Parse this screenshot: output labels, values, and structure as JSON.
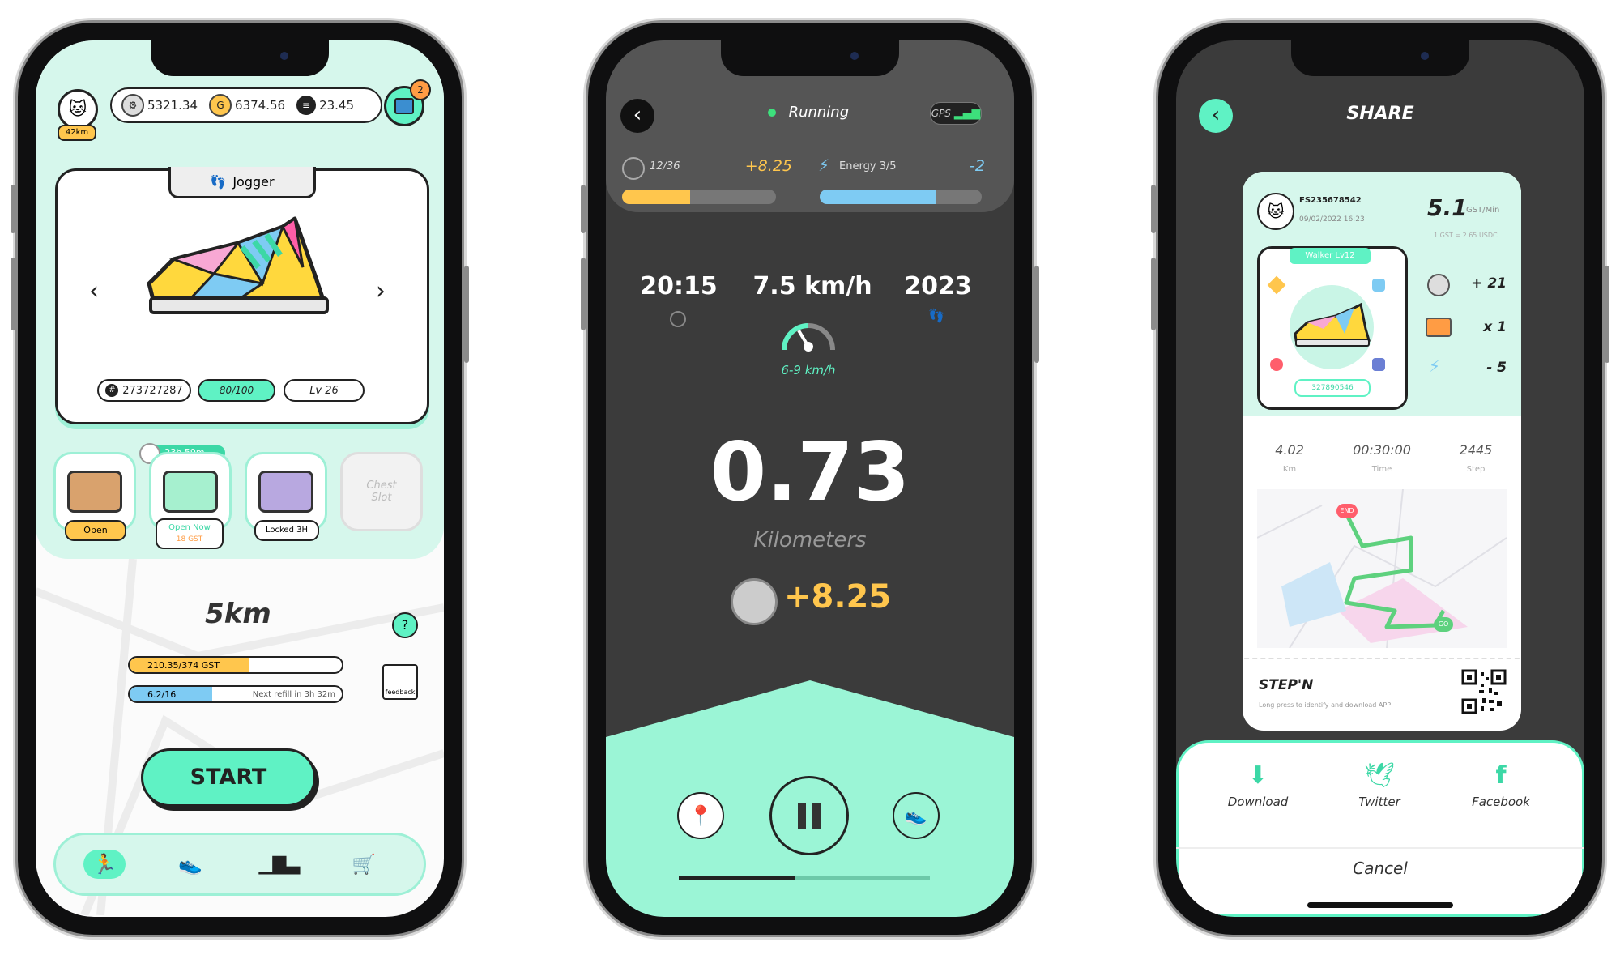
{
  "colors": {
    "mint": "#5ff2c4",
    "mint_light": "#d6f7ec",
    "orange": "#ffc64d",
    "blue": "#7ecbf3",
    "dark": "#3b3b3b"
  },
  "screen1": {
    "distance_badge": "42km",
    "balances": {
      "gst": "5321.34",
      "gmt": "6374.56",
      "sol": "23.45"
    },
    "wallet_badge": "2",
    "sneaker_type": "Jogger",
    "sneaker_id": "273727287",
    "durability": "80/100",
    "level": "Lv 26",
    "chests": [
      {
        "status": "Open"
      },
      {
        "timer": "23h 59m",
        "status": "Open Now",
        "cost": "18 GST"
      },
      {
        "status": "Locked 3H"
      },
      {
        "label": "Chest Slot"
      }
    ],
    "target": "5km",
    "gst_progress": {
      "label": "210.35/374 GST",
      "fraction": 0.56
    },
    "energy": {
      "label": "6.2/16",
      "refill": "Next refill in 3h 32m",
      "fraction": 0.39
    },
    "feedback_label": "feedback",
    "start_label": "START"
  },
  "screen2": {
    "status": "Running",
    "gps_label": "GPS",
    "gst_counter": "12/36",
    "gst_gain": "+8.25",
    "gst_fraction": 0.44,
    "energy_label": "Energy 3/5",
    "energy_change": "-2",
    "energy_fraction": 0.72,
    "time": "20:15",
    "speed": "7.5 km/h",
    "steps": "2023",
    "speed_range": "6-9 km/h",
    "distance": "0.73",
    "distance_unit": "Kilometers",
    "earned": "+8.25"
  },
  "screen3": {
    "title": "SHARE",
    "user_id": "FS235678542",
    "datetime": "09/02/2022 16:23",
    "rate": "5.1",
    "rate_unit": "GST/Min",
    "rate_conversion": "1 GST = 2.65 USDC",
    "sneaker_label": "Walker Lv12",
    "sneaker_id": "327890546",
    "rewards": [
      {
        "value": "+ 21"
      },
      {
        "value": "x 1"
      },
      {
        "value": "- 5"
      }
    ],
    "stats": [
      {
        "value": "4.02",
        "label": "Km"
      },
      {
        "value": "00:30:00",
        "label": "Time"
      },
      {
        "value": "2445",
        "label": "Step"
      }
    ],
    "map_start": "END",
    "map_end": "GO",
    "brand": "STEP'N",
    "qr_caption": "Long press to identify and download APP",
    "actions": [
      {
        "label": "Download"
      },
      {
        "label": "Twitter"
      },
      {
        "label": "Facebook"
      }
    ],
    "cancel_label": "Cancel"
  }
}
